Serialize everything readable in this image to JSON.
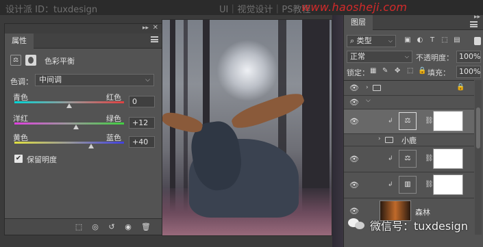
{
  "watermarks": {
    "top_left": "设计派 ID：tuxdesign",
    "top_center": "UI｜视觉设计｜PS教程",
    "top_url": "www.haosheji.com",
    "wechat": "微信号：tuxdesign"
  },
  "properties_panel": {
    "tab": "属性",
    "adjustment_title": "色彩平衡",
    "tone_label": "色调：",
    "tone_value": "中间调",
    "sliders": [
      {
        "left": "青色",
        "right": "红色",
        "value": "0",
        "fraction": 0.5
      },
      {
        "left": "洋红",
        "right": "绿色",
        "value": "+12",
        "fraction": 0.56
      },
      {
        "left": "黄色",
        "right": "蓝色",
        "value": "+40",
        "fraction": 0.7
      }
    ],
    "preserve_luminosity": {
      "label": "保留明度",
      "checked": true
    }
  },
  "layers_panel": {
    "tab": "图层",
    "filter_kind": "类型",
    "blend_mode": "正常",
    "opacity_label": "不透明度：",
    "opacity_value": "100%",
    "lock_label": "锁定：",
    "fill_label": "填充：",
    "fill_value": "100%",
    "layers": [
      {
        "name": "",
        "kind": "group-locked"
      },
      {
        "name": "",
        "kind": "group-open"
      },
      {
        "name": "",
        "kind": "color-balance",
        "selected": true
      },
      {
        "name": "小鹿",
        "kind": "group"
      },
      {
        "name": "",
        "kind": "color-balance"
      },
      {
        "name": "",
        "kind": "levels"
      },
      {
        "name": "森林",
        "kind": "image"
      }
    ]
  },
  "colors": {
    "panel_bg": "#535353",
    "selected_row": "#686868",
    "url_red": "#d42a2a"
  }
}
